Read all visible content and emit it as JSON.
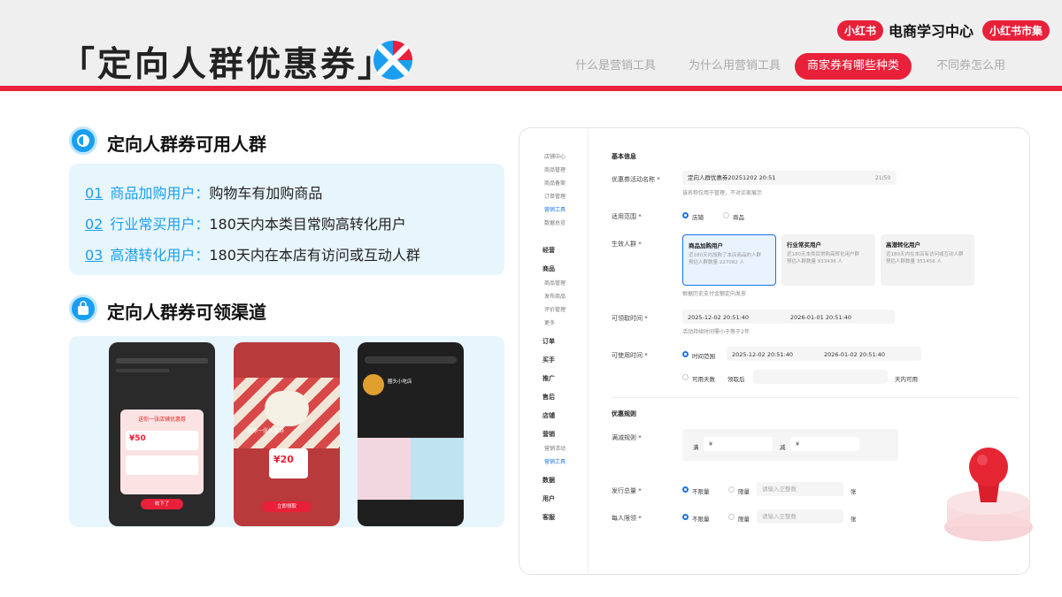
{
  "header": {
    "title": "「定向人群优惠券」",
    "brand_left": "小红书",
    "brand_name": "电商学习中心",
    "brand_right": "小红书市集",
    "nav": [
      "什么是营销工具",
      "为什么用营销工具",
      "商家券有哪些种类",
      "不同券怎么用"
    ]
  },
  "section1": {
    "title": "定向人群券可用人群",
    "rows": [
      {
        "num": "01",
        "label": "商品加购用户：",
        "desc": "购物车有加购商品"
      },
      {
        "num": "02",
        "label": "行业常买用户：",
        "desc": "180天内本类目常购高转化用户"
      },
      {
        "num": "03",
        "label": "高潜转化用户：",
        "desc": "180天内在本店有访问或互动人群"
      }
    ]
  },
  "section2": {
    "title": "定向人群券可领渠道",
    "phone1": {
      "coupon_title": "送你一张店铺优惠券",
      "amount": "¥50",
      "btn": "收下了"
    },
    "phone2": {
      "banner": "送你一张优惠券",
      "amount": "¥20",
      "btn": "立即领取"
    },
    "phone3": {
      "shop": "圈头小吃店"
    }
  },
  "admin": {
    "side_top": [
      "店铺中心",
      "商品管理",
      "商品备案",
      "订单管理",
      "营销工具",
      "数据总览"
    ],
    "side_groups": [
      "经营",
      "商品",
      "订单",
      "买手",
      "推广",
      "售后",
      "店铺",
      "营销",
      "数据",
      "用户",
      "客服"
    ],
    "side_sub_goods": [
      "商品管理",
      "发布商品",
      "评价管理",
      "更多"
    ],
    "side_sub_market": [
      "营销活动",
      "营销工具"
    ],
    "section_basic": "基本信息",
    "name_label": "优惠券活动名称 *",
    "name_value": "定向人群优惠券20251202 20:51",
    "name_count": "21/50",
    "name_hint": "该名称仅用于管理，不对买家展示",
    "scope_label": "适用范围 *",
    "scope_opts": [
      "店铺",
      "商品"
    ],
    "crowd_label": "生效人群 *",
    "cards": [
      {
        "title": "商品加购用户",
        "desc": "近180天内加购了本店商品的人群",
        "count": "预估人群数量 227082 人"
      },
      {
        "title": "行业常买用户",
        "desc": "近180天本类目常购高转化用户群",
        "count": "预估人群数量 933436 人"
      },
      {
        "title": "高潜转化用户",
        "desc": "近180天内在本店有访问或互动人群",
        "count": "预估人群数量 351456 人"
      }
    ],
    "crowd_hint": "根据历史支付金额定向发放",
    "claim_label": "可领取时间 *",
    "claim_start": "2025-12-02 20:51:40",
    "claim_end": "2026-01-01 20:51:40",
    "claim_hint": "活动持续时间需小于等于2年",
    "use_label": "可使用时间 *",
    "use_opt1": "时间范围",
    "use_start": "2025-12-02 20:51:40",
    "use_end": "2026-01-02 20:51:40",
    "use_opt2": "可用天数",
    "use_after": "领取后",
    "use_days": "天内可用",
    "section_rule": "优惠规则",
    "rule_label": "满减规则 *",
    "rule_full": "满",
    "rule_cut": "减",
    "rule_cur1": "¥",
    "rule_cur2": "¥",
    "total_label": "发行总量 *",
    "total_opt1": "不限量",
    "total_opt2": "限量",
    "total_ph": "请输入正整数",
    "total_unit": "张",
    "per_label": "每人限领 *",
    "per_opt1": "不限量",
    "per_opt2": "限量",
    "per_ph": "请输入正整数",
    "per_unit": "张"
  }
}
